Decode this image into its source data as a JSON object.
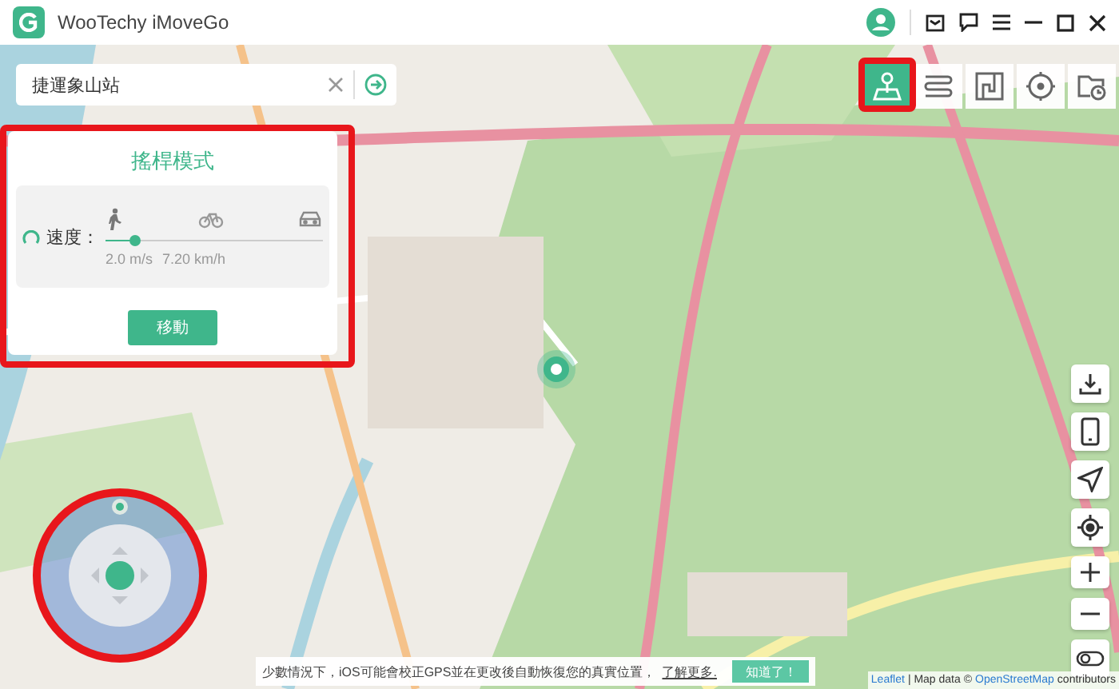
{
  "window": {
    "title": "WooTechy iMoveGo"
  },
  "search": {
    "value": "捷運象山站"
  },
  "modes": [
    {
      "kind": "joystick",
      "selected": true
    },
    {
      "kind": "multi",
      "selected": false
    },
    {
      "kind": "route",
      "selected": false
    },
    {
      "kind": "teleport",
      "selected": false
    },
    {
      "kind": "history",
      "selected": false
    }
  ],
  "panel": {
    "title": "搖桿模式",
    "speed_label": "速度：",
    "transports": [
      {
        "kind": "walk"
      },
      {
        "kind": "bike"
      },
      {
        "kind": "car"
      }
    ],
    "speed": {
      "level": 0.13
    },
    "reading_ms": "2.0 m/s",
    "reading_kmh": "7.20 km/h",
    "button": "移動"
  },
  "map_controls": [
    {
      "kind": "download"
    },
    {
      "kind": "device"
    },
    {
      "kind": "navigate"
    },
    {
      "kind": "locate"
    },
    {
      "kind": "zoom_in"
    },
    {
      "kind": "zoom_out"
    },
    {
      "kind": "toggle"
    }
  ],
  "notice": {
    "text": "少數情況下，iOS可能會校正GPS並在更改後自動恢復您的真實位置，",
    "link": "了解更多.",
    "button": "知道了！"
  },
  "attribution": {
    "leaflet": "Leaflet",
    "text": "| Map data ©",
    "link": "OpenStreetMap",
    "suffix": "contributors"
  }
}
